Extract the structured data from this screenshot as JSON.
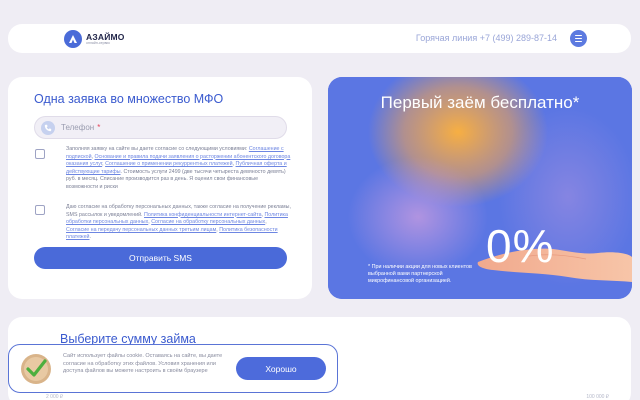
{
  "header": {
    "logo_name": "АЗАЙМО",
    "logo_tagline": "онлайн-сервис",
    "hotline": "Горячая линия +7 (499) 289-87-14"
  },
  "form": {
    "title": "Одна заявка во множество МФО",
    "phone_placeholder": "Телефон",
    "phone_required_mark": "*",
    "consent1": {
      "intro": "Заполняя заявку на сайте вы даете согласие со следующими условиями:",
      "link1": "Соглашение с подпиской",
      "link2": "Основание и правила подачи заявления о расторжении абонентского договора оказания услуг",
      "link3": "Соглашение о применении рекуррентных платежей",
      "link4": "Публичная оферта и действующие тарифы",
      "tail": "Стоимость услуги 2499 (две тысячи четыреста девяносто девять) руб. в месяц. Списание производится раз в день. Я оценил свои финансовые возможности и риски"
    },
    "consent2": {
      "intro": "Даю согласие на обработку персональных данных, также согласие на получение рекламы, SMS рассылок и уведомлений.",
      "link1": "Политика конфиденциальности интернет-сайта",
      "link2": "Политика обработки персональных данных",
      "link3": "Согласие на обработку персональных данных",
      "link4": "Согласие на передачу персональных данных третьим лицам",
      "link5": "Политика безопасности платежей"
    },
    "submit_label": "Отправить SMS"
  },
  "promo": {
    "title": "Первый заём бесплатно*",
    "big_value": "0%",
    "note": "* При наличии акции для новых клиентов выбранной вами партнерской микрофинансовой организацией."
  },
  "sum": {
    "title": "Выберите сумму займа",
    "min_label": "2 000 ₽",
    "max_label": "100 000 ₽"
  },
  "cookie": {
    "text": "Сайт использует файлы cookie. Оставаясь на сайте, вы даете согласие на обработку этих файлов. Условия хранения или доступа файлов вы можете настроить в своём браузере",
    "ok_label": "Хорошо"
  },
  "colors": {
    "accent": "#4a6ad9",
    "background": "#efedf4",
    "link": "#6d86e2"
  }
}
